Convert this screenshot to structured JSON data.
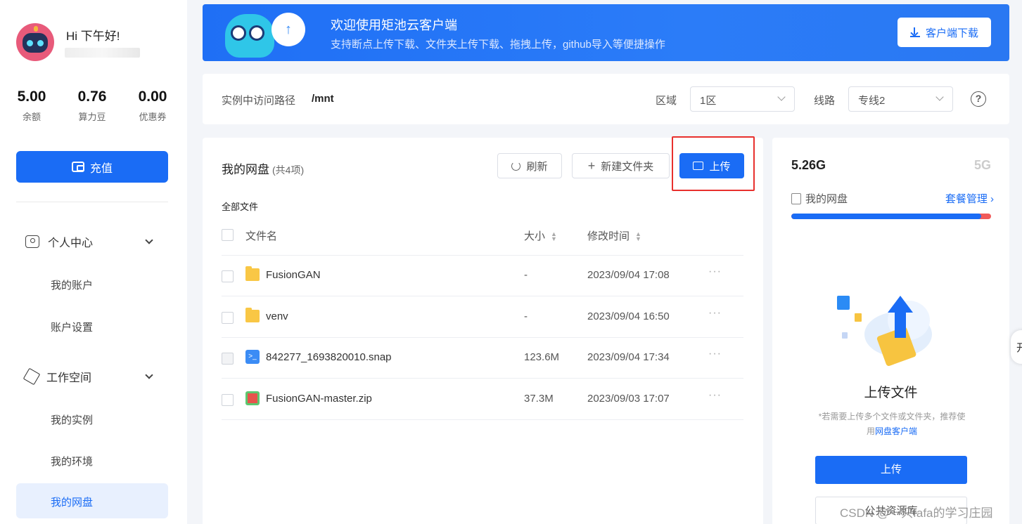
{
  "profile": {
    "greeting": "Hi 下午好!",
    "stats": [
      {
        "value": "5.00",
        "label": "余额"
      },
      {
        "value": "0.76",
        "label": "算力豆"
      },
      {
        "value": "0.00",
        "label": "优惠券"
      }
    ],
    "recharge_label": "充值"
  },
  "nav": {
    "personal": "个人中心",
    "my_account": "我的账户",
    "account_settings": "账户设置",
    "workspace": "工作空间",
    "my_instances": "我的实例",
    "my_env": "我的环境",
    "my_disk": "我的网盘"
  },
  "banner": {
    "title": "欢迎使用矩池云客户端",
    "subtitle": "支持断点上传下载、文件夹上传下载、拖拽上传，github导入等便捷操作",
    "download_label": "客户端下载"
  },
  "pathbar": {
    "label": "实例中访问路径",
    "value": "/mnt",
    "region_label": "区域",
    "region_value": "1区",
    "line_label": "线路",
    "line_value": "专线2",
    "help": "?"
  },
  "files": {
    "title": "我的网盘",
    "count": "(共4项)",
    "refresh_label": "刷新",
    "new_folder_label": "新建文件夹",
    "upload_label": "上传",
    "crumb": "全部文件",
    "headers": {
      "name": "文件名",
      "size": "大小",
      "time": "修改时间"
    },
    "rows": [
      {
        "name": "FusionGAN",
        "size": "-",
        "time": "2023/09/04 17:08",
        "type": "folder"
      },
      {
        "name": "venv",
        "size": "-",
        "time": "2023/09/04 16:50",
        "type": "folder"
      },
      {
        "name": "842277_1693820010.snap",
        "size": "123.6M",
        "time": "2023/09/04 17:34",
        "type": "snap"
      },
      {
        "name": "FusionGAN-master.zip",
        "size": "37.3M",
        "time": "2023/09/03 17:07",
        "type": "zip"
      }
    ],
    "more": "···"
  },
  "storage": {
    "used": "5.26G",
    "total": "5G",
    "disk_label": "我的网盘",
    "package_label": "套餐管理 ›",
    "usage_fraction": 0.95,
    "upload_title": "上传文件",
    "hint_text": "*若需要上传多个文件或文件夹，推荐使用",
    "hint_link": "网盘客户端",
    "upload_btn": "上传",
    "secondary_btn": "公共资源库"
  },
  "overlay": {
    "watermark": "CSDN @一只fafa的学习庄园",
    "side_tab": "开"
  },
  "colors": {
    "accent": "#1a6cf5",
    "highlight_box": "#e8302d",
    "bar_over": "#f05a5a"
  }
}
